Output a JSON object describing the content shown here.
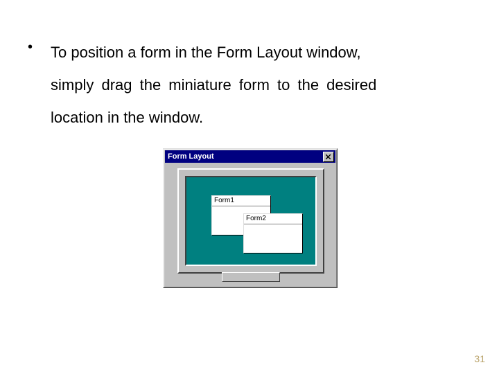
{
  "bullet": {
    "line1": "To position a form in the Form Layout window,",
    "line2": "simply drag the miniature form to the desired",
    "line3": "location in the window."
  },
  "formLayout": {
    "title": "Form Layout",
    "forms": {
      "form1": "Form1",
      "form2": "Form2"
    }
  },
  "pageNumber": "31"
}
